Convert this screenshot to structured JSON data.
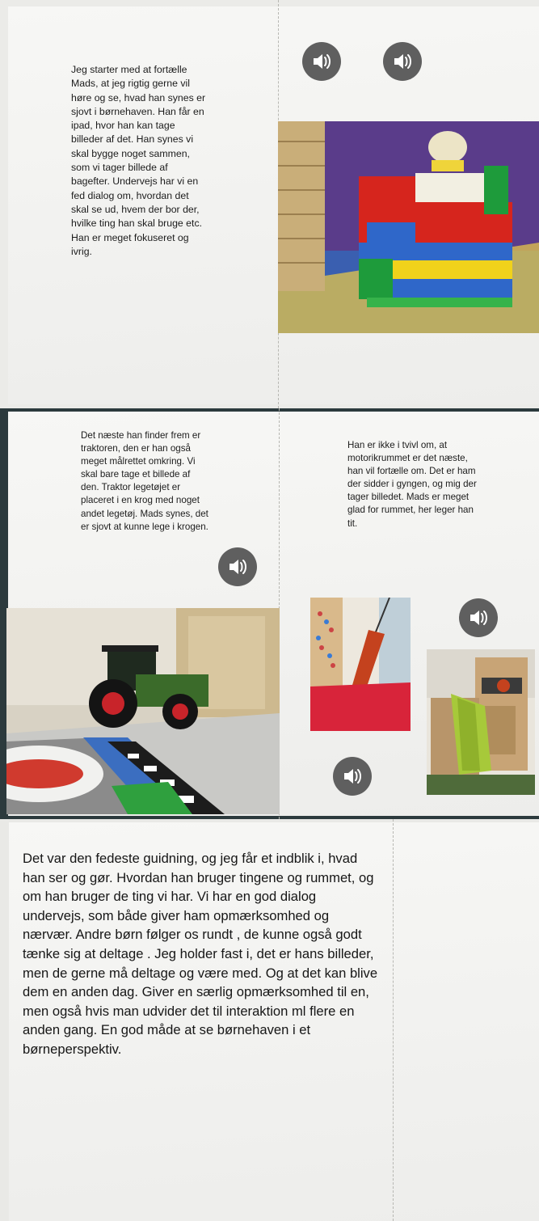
{
  "spreads": [
    {
      "left_text": "Jeg starter med at fortælle Mads, at jeg rigtig gerne vil høre og se, hvad han synes er sjovt i børnehaven. Han får en ipad, hvor han kan tage billeder af det. Han synes vi skal bygge noget sammen, som vi tager billede af bagefter. Undervejs har vi en fed dialog om, hvordan det skal se ud, hvem der bor der, hvilke ting han skal bruge etc. Han er meget fokuseret og ivrig."
    },
    {
      "left_text": "Det næste han finder frem er traktoren, den er han også meget målrettet omkring. Vi skal bare tage et billede af den. Traktor legetøjet er placeret i en krog med noget andet legetøj. Mads synes, det er sjovt at kunne lege i krogen.",
      "right_text": "Han er ikke i tvivl om, at motorikrummet er det næste, han vil fortælle om. Det er ham der sidder i gyngen, og mig der tager billedet. Mads er meget glad for rummet, her leger han tit."
    },
    {
      "left_text": "Det var den fedeste guidning, og jeg får et indblik i, hvad han ser og gør. Hvordan han bruger tingene og rummet, og om han bruger de ting vi har. Vi har en god dialog undervejs, som både giver ham opmærksomhed og nærvær. Andre børn følger os rundt , de kunne også godt tænke sig at deltage . Jeg holder fast i, det er hans billeder, men de gerne må deltage og være med. Og at det kan blive dem en anden dag. Giver en særlig opmærksomhed til en, men også hvis man udvider det til interaktion ml flere en anden gang. En god måde at se børnehaven i et børneperspektiv."
    }
  ],
  "icons": {
    "audio": "speaker-icon",
    "speaker_color": "#5f5f5f"
  }
}
